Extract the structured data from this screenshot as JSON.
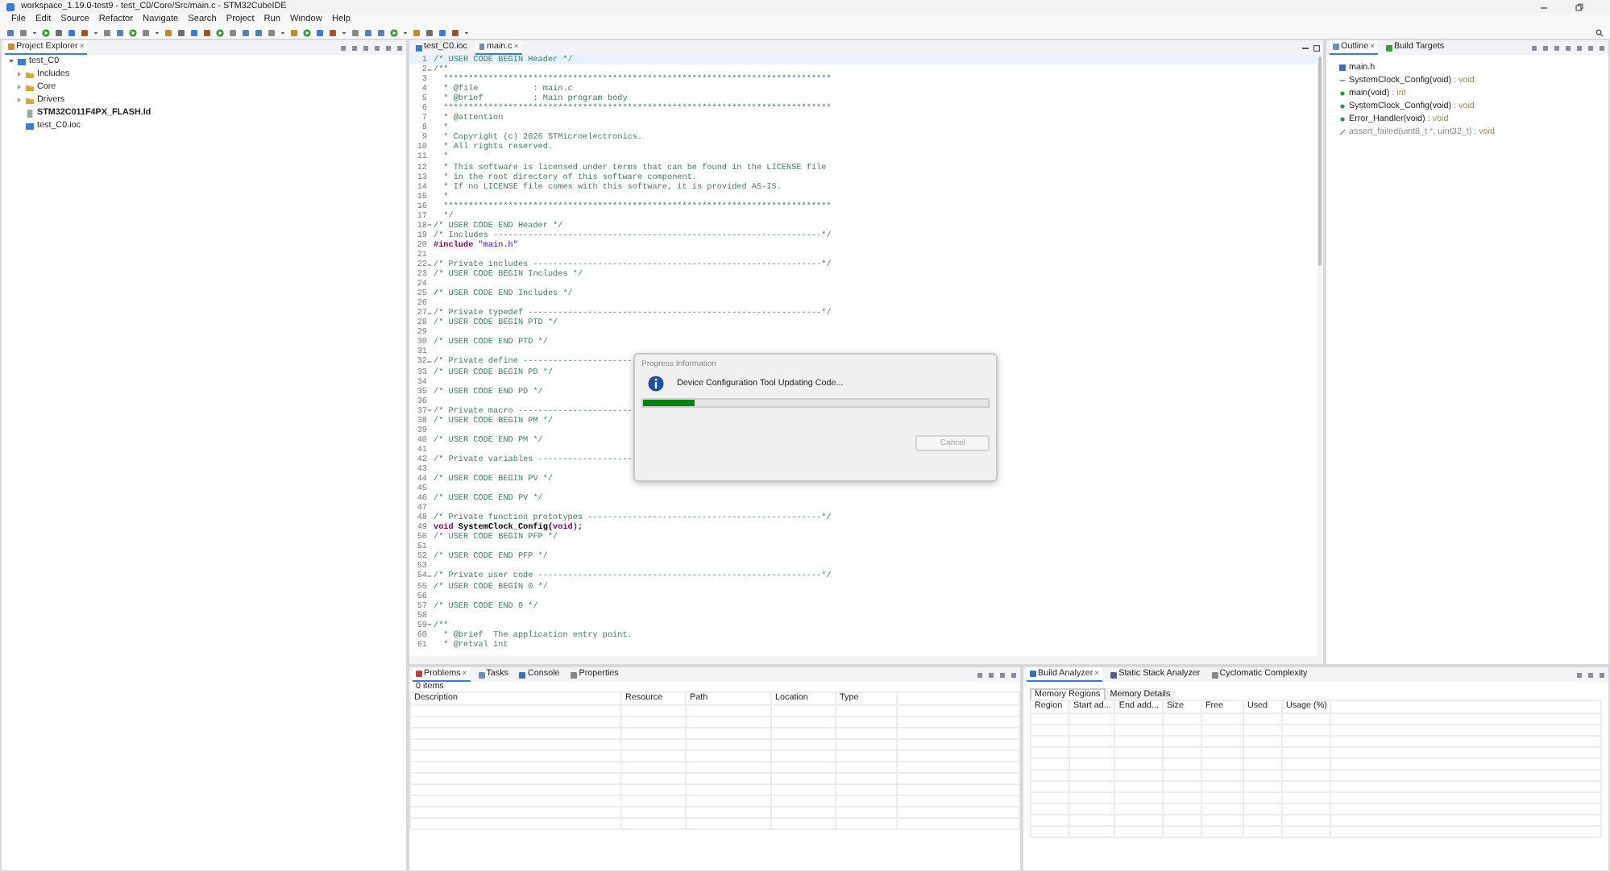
{
  "window": {
    "title": "workspace_1.19.0-test9 - test_C0/Core/Src/main.c - STM32CubeIDE"
  },
  "menu": [
    "File",
    "Edit",
    "Source",
    "Refactor",
    "Navigate",
    "Search",
    "Project",
    "Run",
    "Window",
    "Help"
  ],
  "project_explorer": {
    "title": "Project Explorer",
    "close": "×",
    "tree": [
      {
        "label": "test_C0",
        "kind": "project",
        "expanded": true,
        "children": [
          {
            "label": "Includes",
            "kind": "folder",
            "expanded": false
          },
          {
            "label": "Core",
            "kind": "folder",
            "expanded": false
          },
          {
            "label": "Drivers",
            "kind": "folder",
            "expanded": false
          },
          {
            "label": "STM32C011F4PX_FLASH.ld",
            "kind": "file",
            "bold": true
          },
          {
            "label": "test_C0.ioc",
            "kind": "ioc",
            "bold": false
          }
        ]
      }
    ]
  },
  "editor": {
    "tabs": [
      {
        "label": "test_C0.ioc",
        "kind": "ioc",
        "selected": false
      },
      {
        "label": "main.c",
        "kind": "c",
        "selected": true,
        "close": "×"
      }
    ],
    "lines": [
      {
        "number": "1",
        "fold": false,
        "current": true,
        "segments": [
          {
            "kind": "comment",
            "text": "/* USER CODE BEGIN Header */"
          }
        ]
      },
      {
        "number": "2",
        "fold": true,
        "current": false,
        "segments": [
          {
            "kind": "comment",
            "text": "/**"
          }
        ]
      },
      {
        "number": "3",
        "fold": false,
        "current": false,
        "segments": [
          {
            "kind": "comment",
            "text": "  ******************************************************************************"
          }
        ]
      },
      {
        "number": "4",
        "fold": false,
        "current": false,
        "segments": [
          {
            "kind": "comment",
            "text": "  * @file           : main.c"
          }
        ]
      },
      {
        "number": "5",
        "fold": false,
        "current": false,
        "segments": [
          {
            "kind": "comment",
            "text": "  * @brief          : Main program body"
          }
        ]
      },
      {
        "number": "6",
        "fold": false,
        "current": false,
        "segments": [
          {
            "kind": "comment",
            "text": "  ******************************************************************************"
          }
        ]
      },
      {
        "number": "7",
        "fold": false,
        "current": false,
        "segments": [
          {
            "kind": "comment",
            "text": "  * @attention"
          }
        ]
      },
      {
        "number": "8",
        "fold": false,
        "current": false,
        "segments": [
          {
            "kind": "comment",
            "text": "  *"
          }
        ]
      },
      {
        "number": "9",
        "fold": false,
        "current": false,
        "segments": [
          {
            "kind": "comment",
            "text": "  * Copyright (c) 2026 STMicroelectronics."
          }
        ]
      },
      {
        "number": "10",
        "fold": false,
        "current": false,
        "segments": [
          {
            "kind": "comment",
            "text": "  * All rights reserved."
          }
        ]
      },
      {
        "number": "11",
        "fold": false,
        "current": false,
        "segments": [
          {
            "kind": "comment",
            "text": "  *"
          }
        ]
      },
      {
        "number": "12",
        "fold": false,
        "current": false,
        "segments": [
          {
            "kind": "comment",
            "text": "  * This software is licensed under terms that can be found in the LICENSE file"
          }
        ]
      },
      {
        "number": "13",
        "fold": false,
        "current": false,
        "segments": [
          {
            "kind": "comment",
            "text": "  * in the root directory of this software component."
          }
        ]
      },
      {
        "number": "14",
        "fold": false,
        "current": false,
        "segments": [
          {
            "kind": "comment",
            "text": "  * If no LICENSE file comes with this software, it is provided AS-IS."
          }
        ]
      },
      {
        "number": "15",
        "fold": false,
        "current": false,
        "segments": [
          {
            "kind": "comment",
            "text": "  *"
          }
        ]
      },
      {
        "number": "16",
        "fold": false,
        "current": false,
        "segments": [
          {
            "kind": "comment",
            "text": "  ******************************************************************************"
          }
        ]
      },
      {
        "number": "17",
        "fold": false,
        "current": false,
        "segments": [
          {
            "kind": "comment",
            "text": "  */"
          }
        ]
      },
      {
        "number": "18",
        "fold": true,
        "current": false,
        "segments": [
          {
            "kind": "comment",
            "text": "/* USER CODE END Header */"
          }
        ]
      },
      {
        "number": "19",
        "fold": false,
        "current": false,
        "segments": [
          {
            "kind": "comment",
            "text": "/* Includes ------------------------------------------------------------------*/"
          }
        ]
      },
      {
        "number": "20",
        "fold": false,
        "current": false,
        "segments": [
          {
            "kind": "keyword",
            "text": "#include"
          },
          {
            "kind": "string",
            "text": " \"main.h\""
          }
        ]
      },
      {
        "number": "21",
        "fold": false,
        "current": false
      },
      {
        "number": "22",
        "fold": true,
        "current": false,
        "segments": [
          {
            "kind": "comment",
            "text": "/* Private includes ----------------------------------------------------------*/"
          }
        ]
      },
      {
        "number": "23",
        "fold": false,
        "current": false,
        "segments": [
          {
            "kind": "comment",
            "text": "/* USER CODE BEGIN Includes */"
          }
        ]
      },
      {
        "number": "24",
        "fold": false,
        "current": false
      },
      {
        "number": "25",
        "fold": false,
        "current": false,
        "segments": [
          {
            "kind": "comment",
            "text": "/* USER CODE END Includes */"
          }
        ]
      },
      {
        "number": "26",
        "fold": false,
        "current": false
      },
      {
        "number": "27",
        "fold": true,
        "current": false,
        "segments": [
          {
            "kind": "comment",
            "text": "/* Private typedef -----------------------------------------------------------*/"
          }
        ]
      },
      {
        "number": "28",
        "fold": false,
        "current": false,
        "segments": [
          {
            "kind": "comment",
            "text": "/* USER CODE BEGIN PTD */"
          }
        ]
      },
      {
        "number": "29",
        "fold": false,
        "current": false
      },
      {
        "number": "30",
        "fold": false,
        "current": false,
        "segments": [
          {
            "kind": "comment",
            "text": "/* USER CODE END PTD */"
          }
        ]
      },
      {
        "number": "31",
        "fold": false,
        "current": false
      },
      {
        "number": "32",
        "fold": true,
        "current": false,
        "segments": [
          {
            "kind": "comment",
            "text": "/* Private define ----------------------"
          }
        ]
      },
      {
        "number": "33",
        "fold": false,
        "current": false,
        "segments": [
          {
            "kind": "comment",
            "text": "/* USER CODE BEGIN PD */"
          }
        ]
      },
      {
        "number": "34",
        "fold": false,
        "current": false
      },
      {
        "number": "35",
        "fold": false,
        "current": false,
        "segments": [
          {
            "kind": "comment",
            "text": "/* USER CODE END PD */"
          }
        ]
      },
      {
        "number": "36",
        "fold": false,
        "current": false
      },
      {
        "number": "37",
        "fold": true,
        "current": false,
        "segments": [
          {
            "kind": "comment",
            "text": "/* Private macro -----------------------"
          }
        ]
      },
      {
        "number": "38",
        "fold": false,
        "current": false,
        "segments": [
          {
            "kind": "comment",
            "text": "/* USER CODE BEGIN PM */"
          }
        ]
      },
      {
        "number": "39",
        "fold": false,
        "current": false
      },
      {
        "number": "40",
        "fold": false,
        "current": false,
        "segments": [
          {
            "kind": "comment",
            "text": "/* USER CODE END PM */"
          }
        ]
      },
      {
        "number": "41",
        "fold": false,
        "current": false
      },
      {
        "number": "42",
        "fold": false,
        "current": false,
        "segments": [
          {
            "kind": "comment",
            "text": "/* Private variables -------------------"
          }
        ]
      },
      {
        "number": "43",
        "fold": false,
        "current": false
      },
      {
        "number": "44",
        "fold": false,
        "current": false,
        "segments": [
          {
            "kind": "comment",
            "text": "/* USER CODE BEGIN PV */"
          }
        ]
      },
      {
        "number": "45",
        "fold": false,
        "current": false
      },
      {
        "number": "46",
        "fold": false,
        "current": false,
        "segments": [
          {
            "kind": "comment",
            "text": "/* USER CODE END PV */"
          }
        ]
      },
      {
        "number": "47",
        "fold": false,
        "current": false
      },
      {
        "number": "48",
        "fold": false,
        "current": false,
        "segments": [
          {
            "kind": "comment",
            "text": "/* Private function prototypes -----------------------------------------------*/"
          }
        ]
      },
      {
        "number": "49",
        "fold": false,
        "current": false,
        "segments": [
          {
            "kind": "keyword",
            "text": "void"
          },
          {
            "kind": "function",
            "text": " SystemClock_Config("
          },
          {
            "kind": "keyword",
            "text": "void"
          },
          {
            "kind": "plain",
            "text": ");"
          }
        ]
      },
      {
        "number": "50",
        "fold": false,
        "current": false,
        "segments": [
          {
            "kind": "comment",
            "text": "/* USER CODE BEGIN PFP */"
          }
        ]
      },
      {
        "number": "51",
        "fold": false,
        "current": false
      },
      {
        "number": "52",
        "fold": false,
        "current": false,
        "segments": [
          {
            "kind": "comment",
            "text": "/* USER CODE END PFP */"
          }
        ]
      },
      {
        "number": "53",
        "fold": false,
        "current": false
      },
      {
        "number": "54",
        "fold": true,
        "current": false,
        "segments": [
          {
            "kind": "comment",
            "text": "/* Private user code ---------------------------------------------------------*/"
          }
        ]
      },
      {
        "number": "55",
        "fold": false,
        "current": false,
        "segments": [
          {
            "kind": "comment",
            "text": "/* USER CODE BEGIN 0 */"
          }
        ]
      },
      {
        "number": "56",
        "fold": false,
        "current": false
      },
      {
        "number": "57",
        "fold": false,
        "current": false,
        "segments": [
          {
            "kind": "comment",
            "text": "/* USER CODE END 0 */"
          }
        ]
      },
      {
        "number": "58",
        "fold": false,
        "current": false
      },
      {
        "number": "59",
        "fold": true,
        "current": false,
        "segments": [
          {
            "kind": "comment",
            "text": "/**"
          }
        ]
      },
      {
        "number": "60",
        "fold": false,
        "current": false,
        "segments": [
          {
            "kind": "comment",
            "text": "  * @brief  The application entry point."
          }
        ]
      },
      {
        "number": "61",
        "fold": false,
        "current": false,
        "segments": [
          {
            "kind": "comment",
            "text": "  * @retval int"
          }
        ]
      }
    ]
  },
  "outline": {
    "tabs": [
      {
        "label": "Outline",
        "selected": true,
        "close": "×"
      },
      {
        "label": "Build Targets",
        "selected": false
      }
    ],
    "items": [
      {
        "kind": "include",
        "name": "main.h"
      },
      {
        "kind": "prototype",
        "name": "SystemClock_Config(void)",
        "type": " : void"
      },
      {
        "kind": "function",
        "name": "main(void)",
        "type": " : int"
      },
      {
        "kind": "function",
        "name": "SystemClock_Config(void)",
        "type": " : void"
      },
      {
        "kind": "function",
        "name": "Error_Handler(void)",
        "type": " : void"
      },
      {
        "kind": "inactive",
        "name": "assert_failed(uint8_t *, uint32_t)",
        "type": " : void"
      }
    ]
  },
  "problems": {
    "tabs": [
      {
        "label": "Problems",
        "kind": "problems",
        "selected": true,
        "close": "×"
      },
      {
        "label": "Tasks",
        "kind": "tasks",
        "selected": false
      },
      {
        "label": "Console",
        "kind": "console",
        "selected": false
      },
      {
        "label": "Properties",
        "kind": "properties",
        "selected": false
      }
    ],
    "count": "0 items",
    "columns": [
      "Description",
      "Resource",
      "Path",
      "Location",
      "Type"
    ]
  },
  "build_analyzer": {
    "tabs": [
      {
        "label": "Build Analyzer",
        "selected": true,
        "close": "×"
      },
      {
        "label": "Static Stack Analyzer",
        "selected": false
      },
      {
        "label": "Cyclomatic Complexity",
        "selected": false
      }
    ],
    "subtabs": [
      {
        "label": "Memory Regions",
        "selected": true
      },
      {
        "label": "Memory Details",
        "selected": false
      }
    ],
    "columns": [
      "Region",
      "Start ad...",
      "End add...",
      "Size",
      "Free",
      "Used",
      "Usage (%)"
    ]
  },
  "dialog": {
    "title": "Progress Information",
    "message": "Device Configuration Tool Updating Code...",
    "level": 0.15,
    "button": {
      "label": "Cancel",
      "disabled": true
    }
  }
}
